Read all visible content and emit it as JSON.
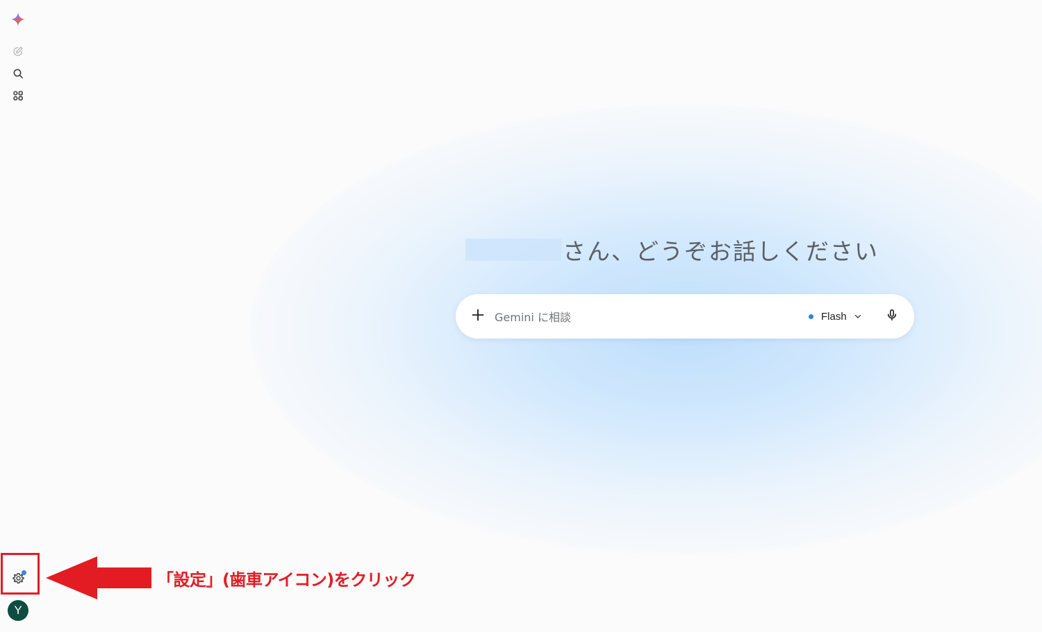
{
  "sidebar": {
    "logo_icon": "gemini-sparkle-icon",
    "items": [
      {
        "name": "new-chat",
        "icon": "edit-pencil-icon"
      },
      {
        "name": "search",
        "icon": "search-icon"
      },
      {
        "name": "explore-gems",
        "icon": "apps-grid-icon"
      }
    ],
    "settings_icon": "gear-icon",
    "settings_notification": true,
    "avatar_initial": "Y",
    "avatar_color": "#0e4d3f"
  },
  "main": {
    "greeting_suffix": "さん、どうぞお話しください",
    "prompt": {
      "placeholder": "Gemini に相談",
      "value": "",
      "model_label": "Flash",
      "model_dot_color": "#2f7cf6"
    }
  },
  "annotation": {
    "callout_text": "「設定」(歯車アイコン)をクリック",
    "color": "#e31c23"
  }
}
